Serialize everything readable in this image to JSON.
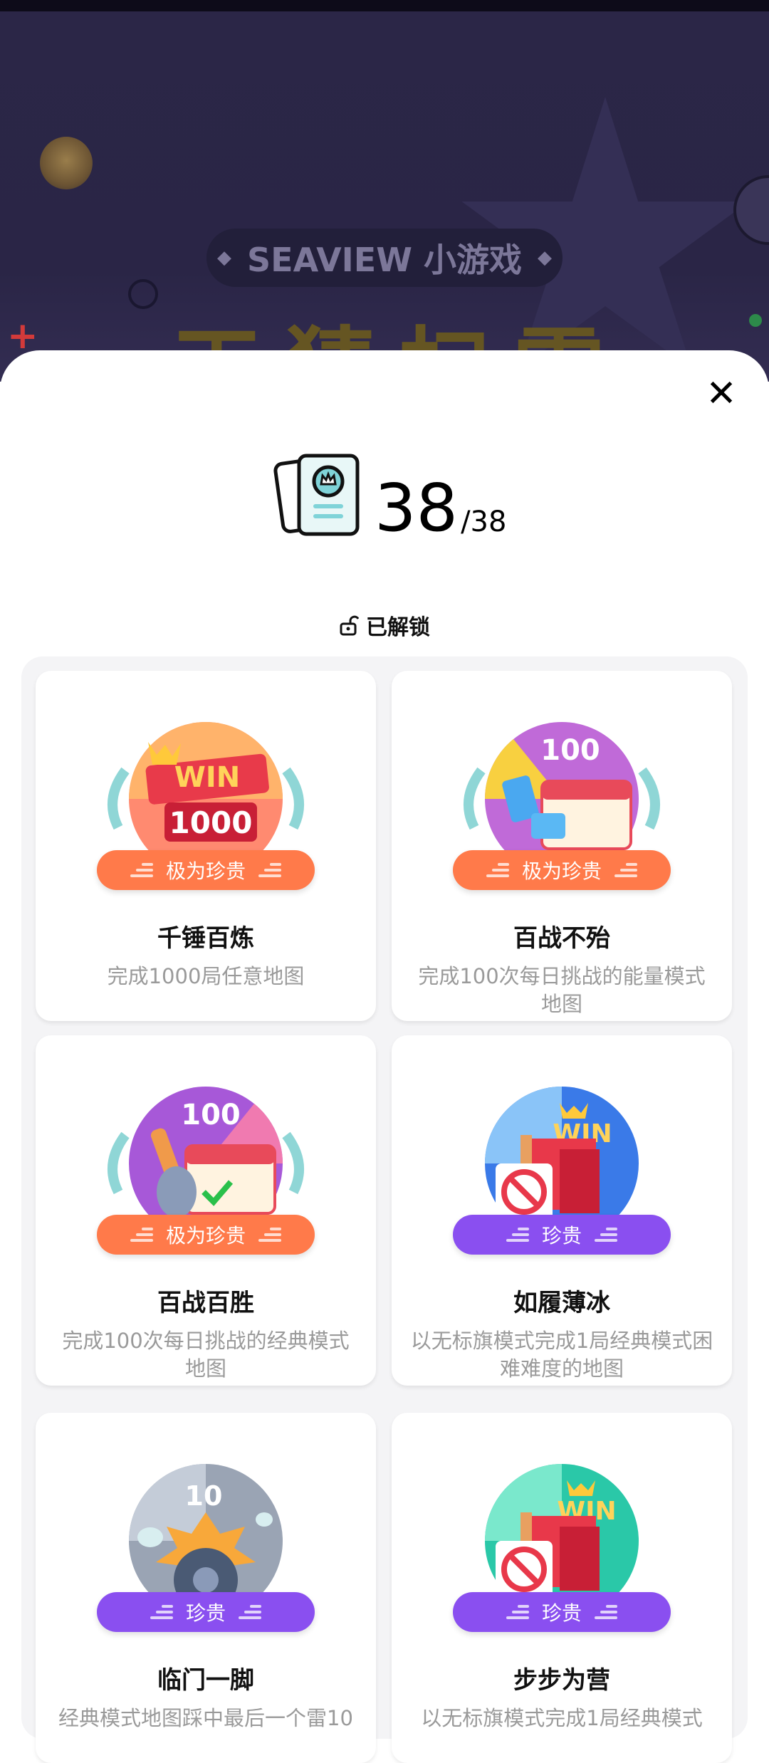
{
  "background": {
    "tag_text": "SEAVIEW 小游戏",
    "diamond_glyph": "◆",
    "title_text": "天猜扫雷"
  },
  "close_icon": "close-icon",
  "counter": {
    "value": "38",
    "total": "/38"
  },
  "section": {
    "label": "已解锁",
    "icon": "unlock-icon"
  },
  "colors": {
    "rare_orange": "#ff7a4a",
    "rare_purple": "#8a4ff0"
  },
  "achievements": [
    {
      "name": "千锤百炼",
      "desc": "完成1000局任意地图",
      "rarity": "极为珍贵",
      "badge_text": "1000",
      "win": "WIN"
    },
    {
      "name": "百战不殆",
      "desc": "完成100次每日挑战的能量模式地图",
      "rarity": "极为珍贵",
      "badge_text": "100"
    },
    {
      "name": "百战百胜",
      "desc": "完成100次每日挑战的经典模式地图",
      "rarity": "极为珍贵",
      "badge_text": "100"
    },
    {
      "name": "如履薄冰",
      "desc": "以无标旗模式完成1局经典模式困难难度的地图",
      "rarity": "珍贵",
      "win": "WIN"
    },
    {
      "name": "临门一脚",
      "desc": "经典模式地图踩中最后一个雷10",
      "rarity": "珍贵",
      "badge_text": "10"
    },
    {
      "name": "步步为营",
      "desc": "以无标旗模式完成1局经典模式",
      "rarity": "珍贵",
      "win": "WIN"
    }
  ]
}
